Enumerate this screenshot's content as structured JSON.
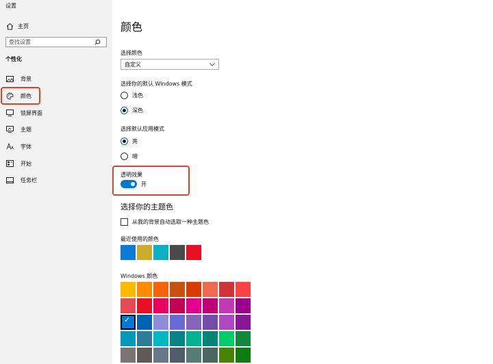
{
  "window": {
    "title": "设置"
  },
  "sidebar": {
    "home_label": "主页",
    "search_placeholder": "查找设置",
    "section_heading": "个性化",
    "items": [
      {
        "label": "背景",
        "icon": "image-icon"
      },
      {
        "label": "颜色",
        "icon": "palette-icon",
        "selected": true
      },
      {
        "label": "锁屏界面",
        "icon": "lock-screen-icon"
      },
      {
        "label": "主题",
        "icon": "theme-icon"
      },
      {
        "label": "字体",
        "icon": "font-icon"
      },
      {
        "label": "开始",
        "icon": "start-icon"
      },
      {
        "label": "任务栏",
        "icon": "taskbar-icon"
      }
    ]
  },
  "main": {
    "page_title": "颜色",
    "choose_color": {
      "label": "选择颜色",
      "value": "自定义"
    },
    "windows_mode": {
      "label": "选择你的默认 Windows 模式",
      "options": [
        {
          "label": "浅色",
          "checked": false
        },
        {
          "label": "深色",
          "checked": true
        }
      ]
    },
    "app_mode": {
      "label": "选择默认应用模式",
      "options": [
        {
          "label": "亮",
          "checked": true
        },
        {
          "label": "暗",
          "checked": false
        }
      ]
    },
    "transparency": {
      "label": "透明效果",
      "state_label": "开",
      "on": true
    },
    "accent": {
      "title": "选择你的主题色",
      "auto_label": "从我的背景自动选取一种主题色",
      "auto_checked": false,
      "recent_label": "最近使用的颜色",
      "recent_colors": [
        "#0a7bd8",
        "#c9ad2b",
        "#0eafc0",
        "#4b4b4b",
        "#e81123"
      ],
      "windows_label": "Windows 颜色",
      "windows_colors": [
        [
          "#ffb900",
          "#ff8c00",
          "#f7630c",
          "#ca5010",
          "#da3b01",
          "#ef6950",
          "#d13438",
          "#ff4343"
        ],
        [
          "#e74856",
          "#e81123",
          "#ea005e",
          "#c30052",
          "#e3008c",
          "#bf0077",
          "#c239b3",
          "#9a0089"
        ],
        [
          "#0078d7",
          "#0063b1",
          "#8e8cd8",
          "#6b69d6",
          "#8764b8",
          "#744da9",
          "#b146c2",
          "#881798"
        ],
        [
          "#0099bc",
          "#2d7d9a",
          "#00b7c3",
          "#038387",
          "#00b294",
          "#018574",
          "#00cc6a",
          "#10893e"
        ],
        [
          "#7a7574",
          "#5d5a58",
          "#68768a",
          "#515c6b",
          "#567c73",
          "#486860",
          "#498205",
          "#107c10"
        ]
      ],
      "selected_windows_color": "#0078d7"
    }
  },
  "colors": {
    "accent": "#0078d7",
    "highlight_box": "#d9472b",
    "sidebar_bg": "#f2f2f2"
  }
}
